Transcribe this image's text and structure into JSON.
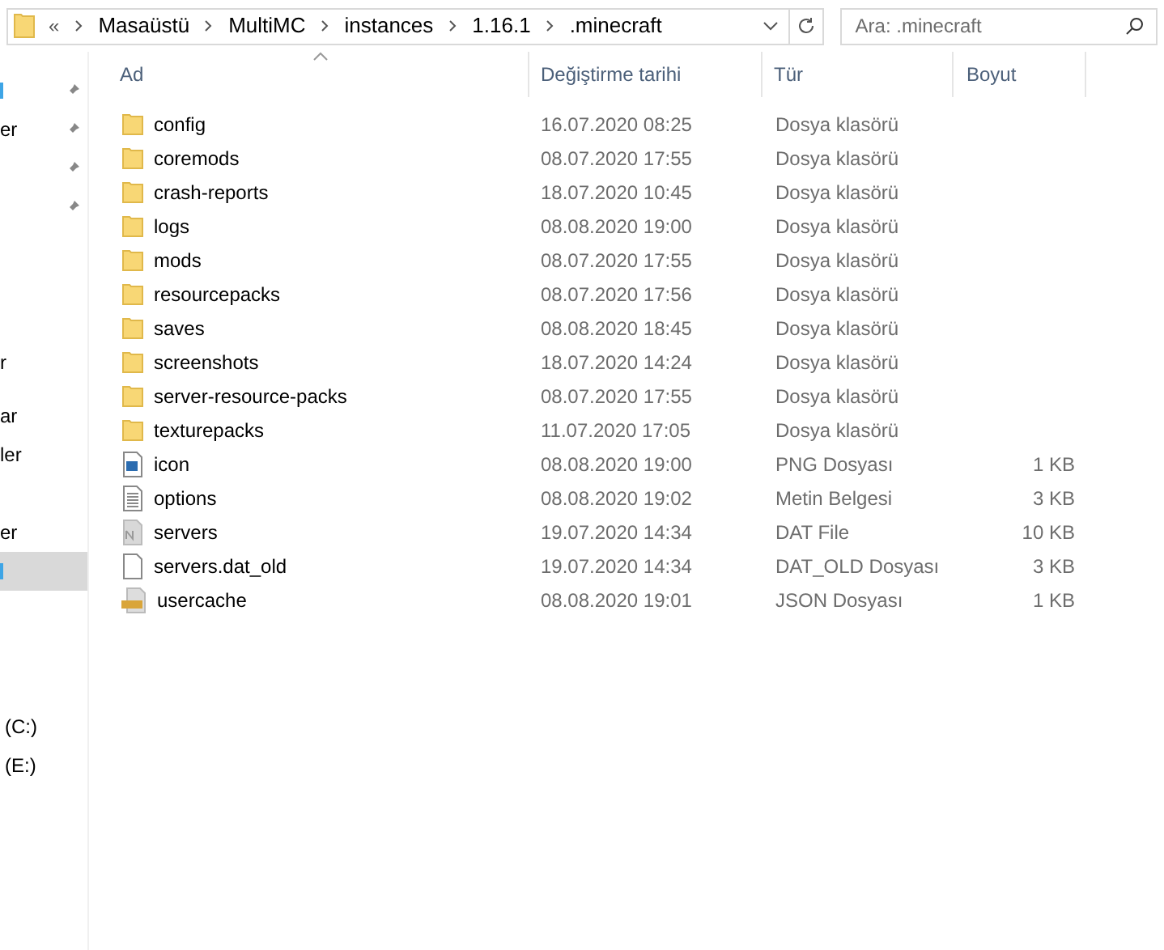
{
  "address_bar": {
    "overflow": "«",
    "path": [
      "Masaüstü",
      "MultiMC",
      "instances",
      "1.16.1",
      ".minecraft"
    ]
  },
  "search": {
    "placeholder": "Ara: .minecraft"
  },
  "sidebar": {
    "items": [
      {
        "pinned": true,
        "selected": false
      },
      {
        "text": "er",
        "pinned": true,
        "selected": false
      },
      {
        "pinned": true,
        "selected": false
      },
      {
        "pinned": true,
        "selected": false
      },
      {
        "text": "r",
        "pinned": false,
        "selected": false
      },
      {
        "text": "ar",
        "pinned": false,
        "selected": false
      },
      {
        "text": "ler",
        "pinned": false,
        "selected": false
      },
      {
        "text": "er",
        "pinned": false,
        "selected": false
      },
      {
        "pinned": false,
        "selected": true
      },
      {
        "text": "(C:)",
        "pinned": false,
        "selected": false
      },
      {
        "text": "(E:)",
        "pinned": false,
        "selected": false
      }
    ]
  },
  "table": {
    "columns": [
      "Ad",
      "Değiştirme tarihi",
      "Tür",
      "Boyut"
    ],
    "rows": [
      {
        "kind": "folder",
        "name": "config",
        "date": "16.07.2020 08:25",
        "type": "Dosya klasörü"
      },
      {
        "kind": "folder",
        "name": "coremods",
        "date": "08.07.2020 17:55",
        "type": "Dosya klasörü"
      },
      {
        "kind": "folder",
        "name": "crash-reports",
        "date": "18.07.2020 10:45",
        "type": "Dosya klasörü"
      },
      {
        "kind": "folder",
        "name": "logs",
        "date": "08.08.2020 19:00",
        "type": "Dosya klasörü"
      },
      {
        "kind": "folder",
        "name": "mods",
        "date": "08.07.2020 17:55",
        "type": "Dosya klasörü"
      },
      {
        "kind": "folder",
        "name": "resourcepacks",
        "date": "08.07.2020 17:56",
        "type": "Dosya klasörü"
      },
      {
        "kind": "folder",
        "name": "saves",
        "date": "08.08.2020 18:45",
        "type": "Dosya klasörü"
      },
      {
        "kind": "folder",
        "name": "screenshots",
        "date": "18.07.2020 14:24",
        "type": "Dosya klasörü"
      },
      {
        "kind": "folder",
        "name": "server-resource-packs",
        "date": "08.07.2020 17:55",
        "type": "Dosya klasörü"
      },
      {
        "kind": "folder",
        "name": "texturepacks",
        "date": "11.07.2020 17:05",
        "type": "Dosya klasörü"
      },
      {
        "kind": "image",
        "name": "icon",
        "date": "08.08.2020 19:00",
        "type": "PNG Dosyası",
        "size": "1 KB"
      },
      {
        "kind": "text",
        "name": "options",
        "date": "08.08.2020 19:02",
        "type": "Metin Belgesi",
        "size": "3 KB"
      },
      {
        "kind": "nbt",
        "name": "servers",
        "date": "19.07.2020 14:34",
        "type": "DAT File",
        "size": "10 KB"
      },
      {
        "kind": "blank",
        "name": "servers.dat_old",
        "date": "19.07.2020 14:34",
        "type": "DAT_OLD Dosyası",
        "size": "3 KB"
      },
      {
        "kind": "json",
        "name": "usercache",
        "date": "08.08.2020 19:01",
        "type": "JSON Dosyası",
        "size": "1 KB"
      }
    ]
  }
}
